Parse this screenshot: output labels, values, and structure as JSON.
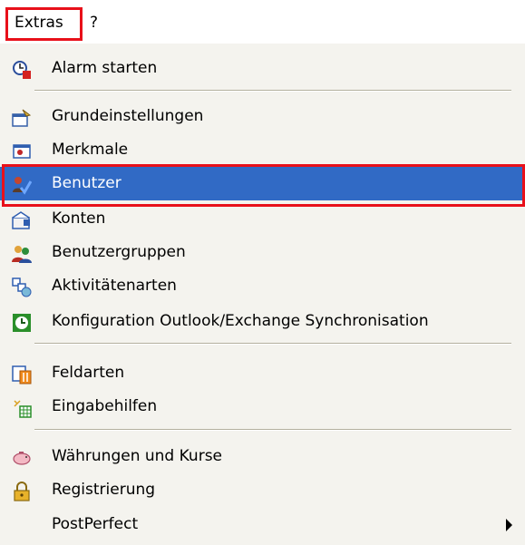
{
  "menubar": {
    "extras": "Extras",
    "help": "?"
  },
  "menu": {
    "alarm": "Alarm starten",
    "grundeinstellungen": "Grundeinstellungen",
    "merkmale": "Merkmale",
    "benutzer": "Benutzer",
    "konten": "Konten",
    "benutzergruppen": "Benutzergruppen",
    "aktivitaetenarten": "Aktivitätenarten",
    "konfiguration": "Konfiguration Outlook/Exchange Synchronisation",
    "feldarten": "Feldarten",
    "eingabehilfen": "Eingabehilfen",
    "waehrungen": "Währungen und Kurse",
    "registrierung": "Registrierung",
    "postperfect": "PostPerfect"
  },
  "colors": {
    "highlight": "#316ac5",
    "menu_bg": "#f4f3ee",
    "outline": "#e8101a"
  }
}
